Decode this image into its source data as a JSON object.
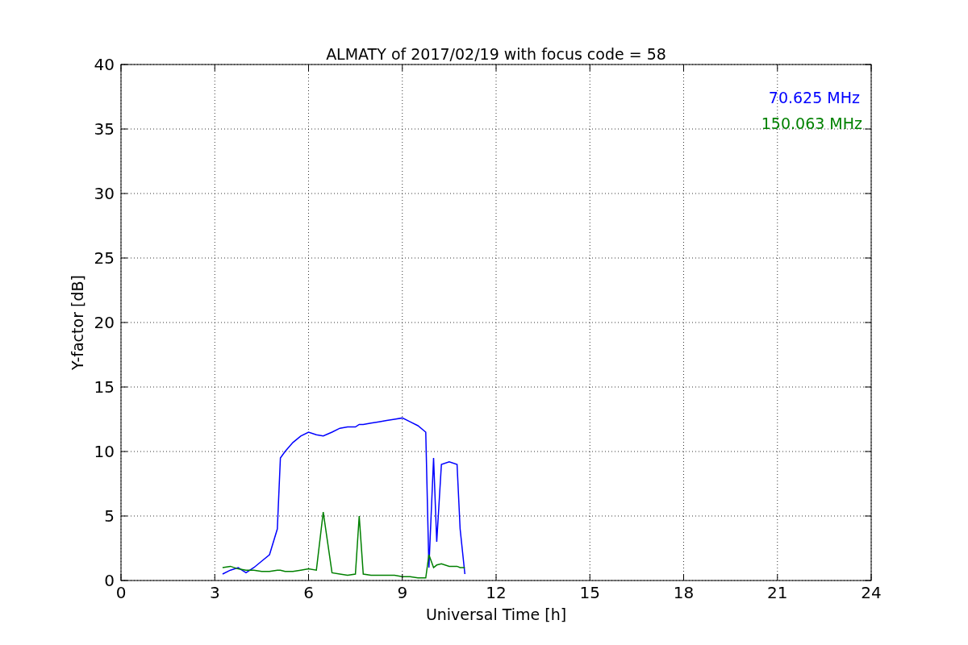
{
  "chart_data": {
    "type": "line",
    "grid": true,
    "title": "ALMATY of 2017/02/19 with focus code = 58",
    "xlabel": "Universal Time [h]",
    "ylabel": "Y-factor [dB]",
    "xlim": [
      0,
      24
    ],
    "ylim": [
      0,
      40
    ],
    "xticks": [
      0,
      3,
      6,
      9,
      12,
      15,
      18,
      21,
      24
    ],
    "yticks": [
      0,
      5,
      10,
      15,
      20,
      25,
      30,
      35,
      40
    ],
    "x": [
      3.25,
      3.5,
      3.75,
      4,
      4.25,
      4.5,
      4.75,
      5,
      5.1,
      5.25,
      5.5,
      5.75,
      6,
      6.25,
      6.47,
      6.75,
      7,
      7.25,
      7.5,
      7.62,
      7.75,
      8,
      8.25,
      8.5,
      8.75,
      9,
      9.25,
      9.5,
      9.75,
      9.85,
      10,
      10.1,
      10.25,
      10.5,
      10.75,
      10.85,
      11
    ],
    "series": [
      {
        "name": "70.625 MHz",
        "color": "#0000ff",
        "values": [
          0.5,
          0.8,
          1.0,
          0.6,
          1.0,
          1.5,
          2.0,
          4.0,
          9.5,
          10.0,
          10.7,
          11.2,
          11.5,
          11.3,
          11.2,
          11.5,
          11.8,
          11.9,
          11.9,
          12.1,
          12.1,
          12.2,
          12.3,
          12.4,
          12.5,
          12.6,
          12.3,
          12.0,
          11.5,
          1.0,
          9.5,
          3.0,
          9.0,
          9.2,
          9.0,
          4.0,
          0.5
        ]
      },
      {
        "name": "150.063 MHz",
        "color": "#008000",
        "values": [
          1.0,
          1.1,
          0.9,
          0.8,
          0.8,
          0.7,
          0.7,
          0.8,
          0.8,
          0.7,
          0.7,
          0.8,
          0.9,
          0.8,
          5.3,
          0.6,
          0.5,
          0.4,
          0.5,
          5.0,
          0.5,
          0.4,
          0.4,
          0.4,
          0.4,
          0.3,
          0.3,
          0.2,
          0.2,
          2.0,
          1.0,
          1.2,
          1.3,
          1.1,
          1.1,
          1.0,
          1.0
        ]
      }
    ]
  }
}
